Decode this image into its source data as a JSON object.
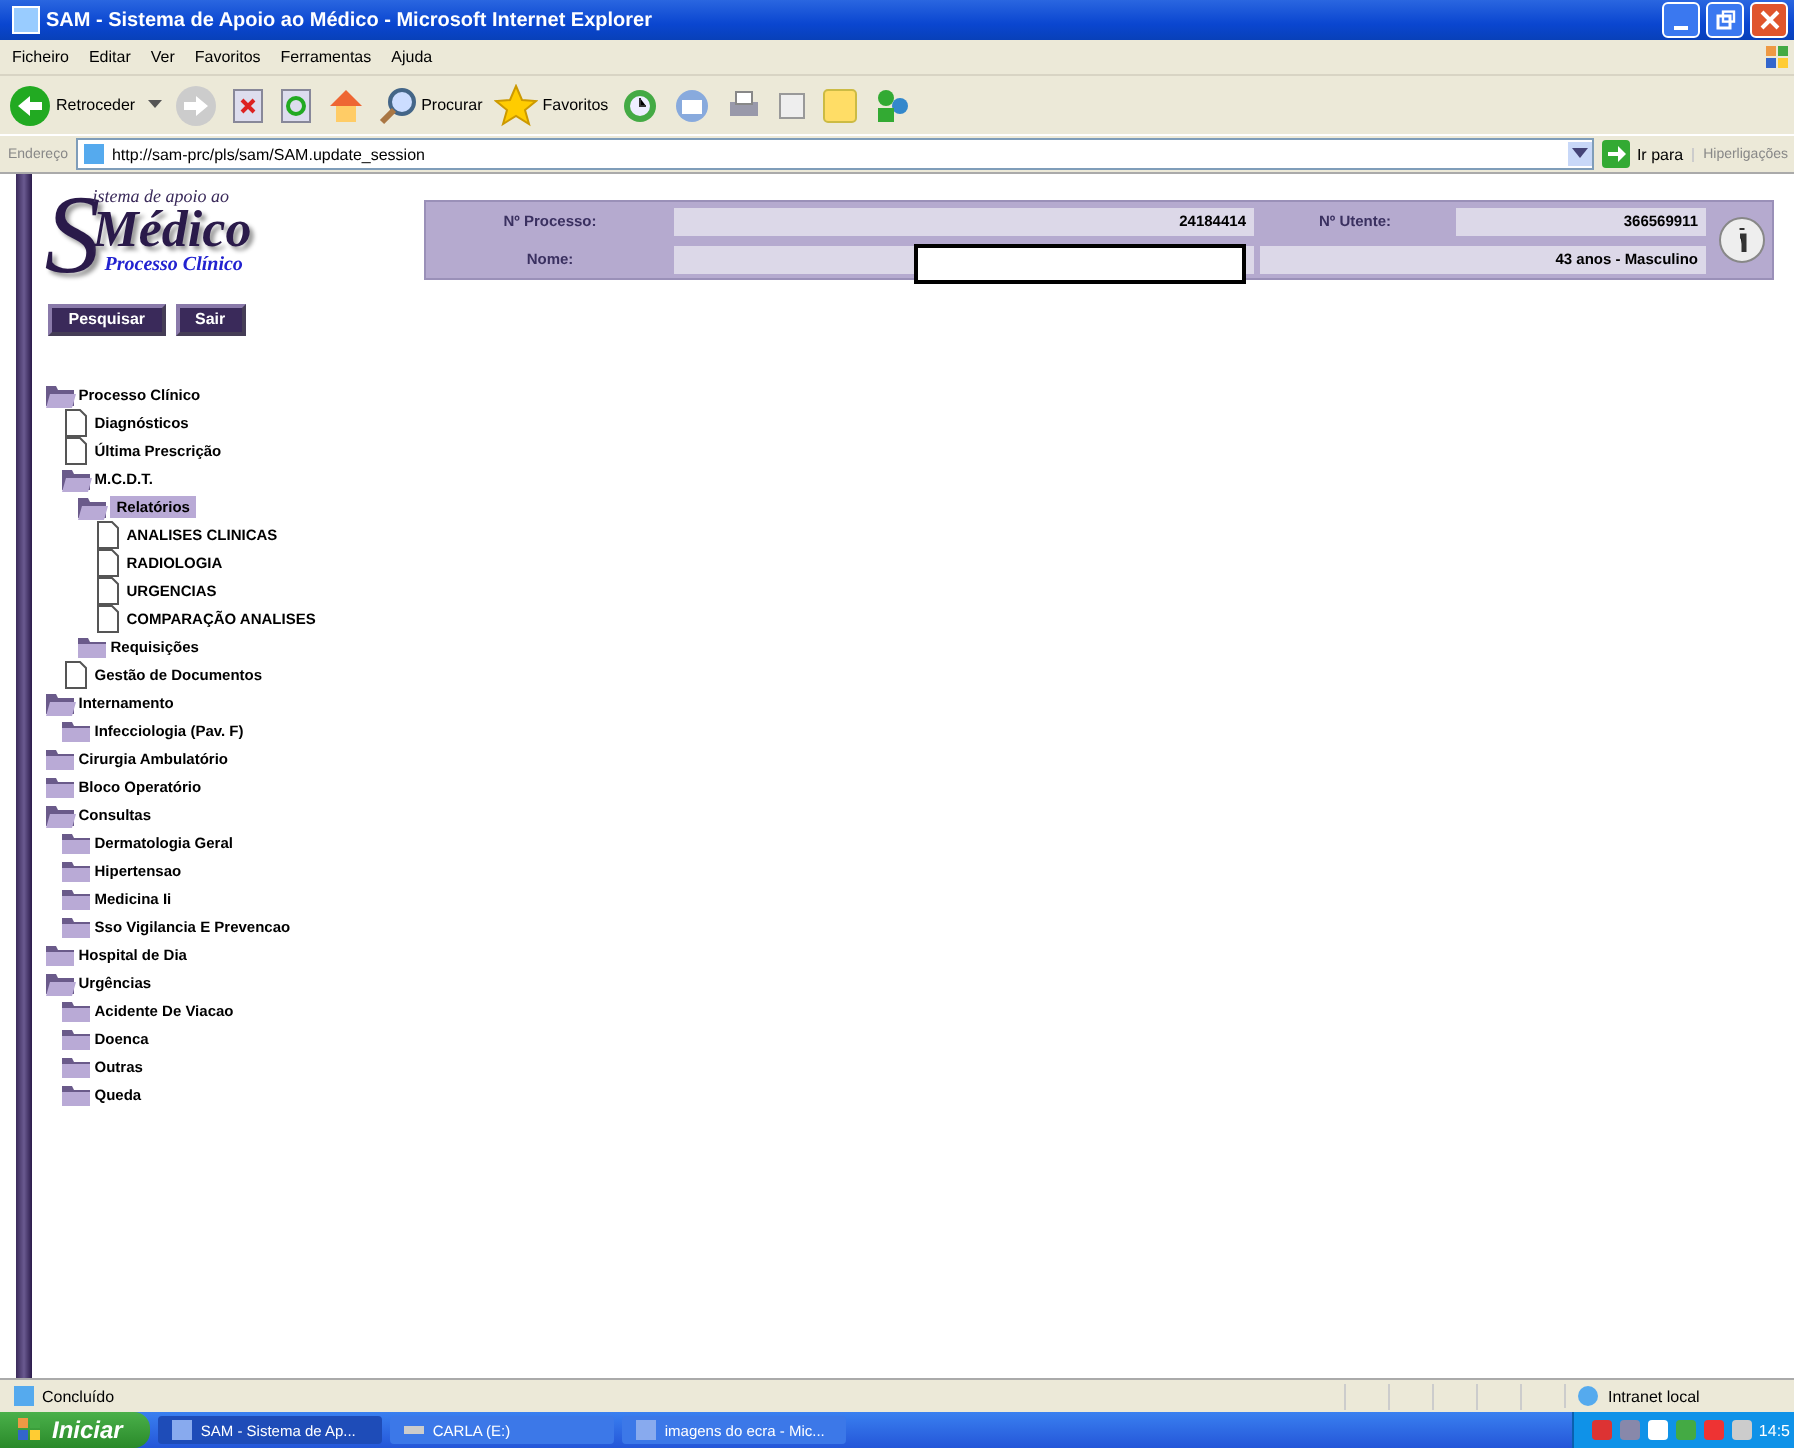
{
  "window": {
    "title": "SAM - Sistema de Apoio ao Médico - Microsoft Internet Explorer"
  },
  "menu": [
    "Ficheiro",
    "Editar",
    "Ver",
    "Favoritos",
    "Ferramentas",
    "Ajuda"
  ],
  "toolbar": {
    "back": "Retroceder",
    "search": "Procurar",
    "favorites": "Favoritos"
  },
  "address": {
    "label": "Endereço",
    "value": "http://sam-prc/pls/sam/SAM.update_session",
    "go": "Ir para",
    "links": "Hiperligações"
  },
  "logo": {
    "line1": "istema de apoio ao",
    "initial": "S",
    "line2": "Médico",
    "line3": "Processo Clínico"
  },
  "buttons": [
    "Pesquisar",
    "Sair"
  ],
  "patient": {
    "process_label": "Nº Processo:",
    "process_value": "24184414",
    "user_label": "Nº Utente:",
    "user_value": "366569911",
    "name_label": "Nome:",
    "age_sex": "43 anos  -  Masculino"
  },
  "tree": [
    {
      "label": "Processo Clínico",
      "kind": "folder",
      "expanded": true,
      "selected": false,
      "children": [
        {
          "label": "Diagnósticos",
          "kind": "doc",
          "selected": false
        },
        {
          "label": "Última Prescrição",
          "kind": "doc",
          "selected": false
        },
        {
          "label": "M.C.D.T.",
          "kind": "folder",
          "expanded": true,
          "selected": false,
          "children": [
            {
              "label": "Relatórios",
              "kind": "folder",
              "expanded": true,
              "selected": true,
              "children": [
                {
                  "label": "ANALISES CLINICAS",
                  "kind": "doc",
                  "selected": false
                },
                {
                  "label": "RADIOLOGIA",
                  "kind": "doc",
                  "selected": false
                },
                {
                  "label": "URGENCIAS",
                  "kind": "doc",
                  "selected": false
                },
                {
                  "label": "COMPARAÇÃO ANALISES",
                  "kind": "doc",
                  "selected": false
                }
              ]
            },
            {
              "label": "Requisições",
              "kind": "folder",
              "expanded": false,
              "selected": false
            }
          ]
        },
        {
          "label": "Gestão de Documentos",
          "kind": "doc",
          "selected": false
        }
      ]
    },
    {
      "label": "Internamento",
      "kind": "folder",
      "expanded": true,
      "selected": false,
      "children": [
        {
          "label": "Infecciologia (Pav. F)",
          "kind": "folder",
          "expanded": false,
          "selected": false
        }
      ]
    },
    {
      "label": "Cirurgia Ambulatório",
      "kind": "folder",
      "expanded": false,
      "selected": false
    },
    {
      "label": "Bloco Operatório",
      "kind": "folder",
      "expanded": false,
      "selected": false
    },
    {
      "label": "Consultas",
      "kind": "folder",
      "expanded": true,
      "selected": false,
      "children": [
        {
          "label": "Dermatologia Geral",
          "kind": "folder",
          "expanded": false,
          "selected": false
        },
        {
          "label": "Hipertensao",
          "kind": "folder",
          "expanded": false,
          "selected": false
        },
        {
          "label": "Medicina Ii",
          "kind": "folder",
          "expanded": false,
          "selected": false
        },
        {
          "label": "Sso Vigilancia E Prevencao",
          "kind": "folder",
          "expanded": false,
          "selected": false
        }
      ]
    },
    {
      "label": "Hospital de Dia",
      "kind": "folder",
      "expanded": false,
      "selected": false
    },
    {
      "label": "Urgências",
      "kind": "folder",
      "expanded": true,
      "selected": false,
      "children": [
        {
          "label": "Acidente De Viacao",
          "kind": "folder",
          "expanded": false,
          "selected": false
        },
        {
          "label": "Doenca",
          "kind": "folder",
          "expanded": false,
          "selected": false
        },
        {
          "label": "Outras",
          "kind": "folder",
          "expanded": false,
          "selected": false
        },
        {
          "label": "Queda",
          "kind": "folder",
          "expanded": false,
          "selected": false
        }
      ]
    }
  ],
  "status_bar": {
    "text": "Concluído",
    "zone": "Intranet local"
  },
  "taskbar": {
    "start": "Iniciar",
    "tasks": [
      "SAM - Sistema de Ap...",
      "CARLA (E:)",
      "imagens do ecra - Mic..."
    ],
    "clock": "14:5"
  }
}
